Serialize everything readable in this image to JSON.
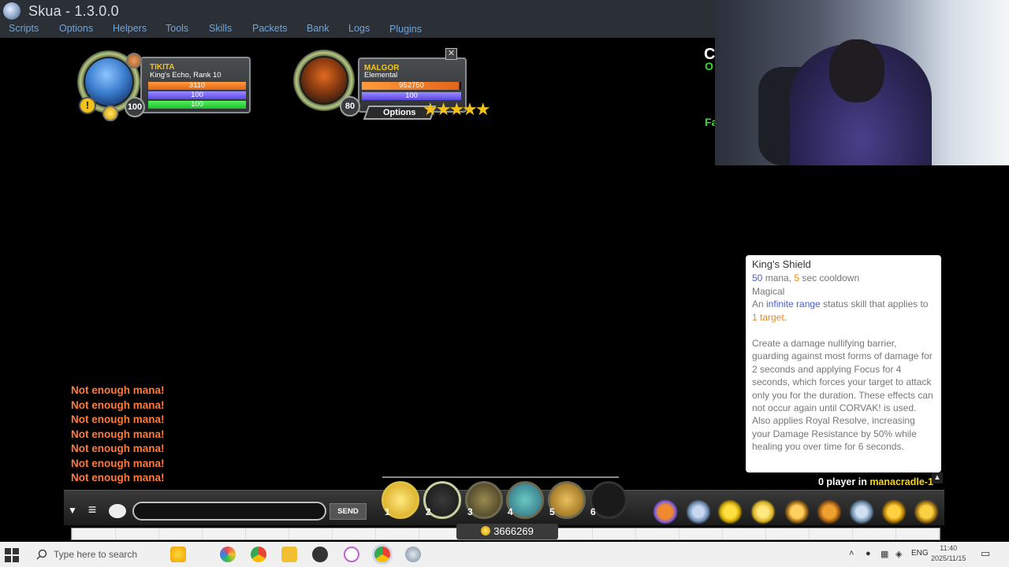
{
  "window": {
    "title": "Skua - 1.3.0.0"
  },
  "menu": {
    "items": [
      "Scripts",
      "Options",
      "Helpers",
      "Tools",
      "Skills",
      "Packets",
      "Bank",
      "Logs",
      "Plugins"
    ]
  },
  "player": {
    "name": "TIKITA",
    "subtitle": "King's Echo, Rank 10",
    "hp": "3110",
    "mp": "100",
    "sp": "100",
    "level": "100"
  },
  "target": {
    "name": "MALGOR",
    "subtitle": "Elemental",
    "hp": "952750",
    "mp": "100",
    "level": "80",
    "options_label": "Options",
    "stars": "★★★★★"
  },
  "tooltip": {
    "title": "King's Shield",
    "mana_value": "50",
    "mana_label": " mana, ",
    "cooldown_value": "5",
    "cooldown_label": " sec cooldown",
    "type": "Magical",
    "desc_prefix": "An ",
    "range": "infinite range",
    "desc_mid": " status skill that applies to ",
    "targets": "1 target",
    "desc_end": ".",
    "body": "Create a damage nullifying barrier, guarding against most forms of damage for 2 seconds and applying Focus for 4 seconds, which forces your target to attack only you for the duration. These effects can not occur again until CORVAK! is used. Also applies Royal Resolve, increasing your Damage Resistance by 50% while healing you over time for 6 seconds."
  },
  "chat": {
    "messages": [
      "Not enough mana!",
      "Not enough mana!",
      "Not enough mana!",
      "Not enough mana!",
      "Not enough mana!",
      "Not enough mana!",
      "Not enough mana!"
    ]
  },
  "side_text": {
    "a": "C",
    "b": "O",
    "c": "Fa"
  },
  "room": {
    "count_text": "0 player in ",
    "name": "manacradle-1"
  },
  "chatbar": {
    "send_label": "SEND"
  },
  "skills": {
    "numbers": [
      "1",
      "2",
      "3",
      "4",
      "5",
      "6"
    ]
  },
  "gold": "3666269",
  "taskbar": {
    "search_placeholder": "Type here to search",
    "time": "11:40",
    "date": "2025/11/15",
    "lang": "ENG"
  },
  "colors": {
    "menu_text": "#6fa4dc",
    "name_gold": "#f2c21b",
    "warning_orange": "#ff7a3a",
    "tooltip_blue": "#4a5fd0",
    "tooltip_orange": "#f08a1a",
    "room_yellow": "#f2d21b"
  },
  "icons": {
    "start": "windows-logo-icon",
    "search": "magnifier-icon",
    "chat_toggle": "chevron-down-icon",
    "menu": "hamburger-icon",
    "chat_bubble": "speech-bubble-icon"
  }
}
